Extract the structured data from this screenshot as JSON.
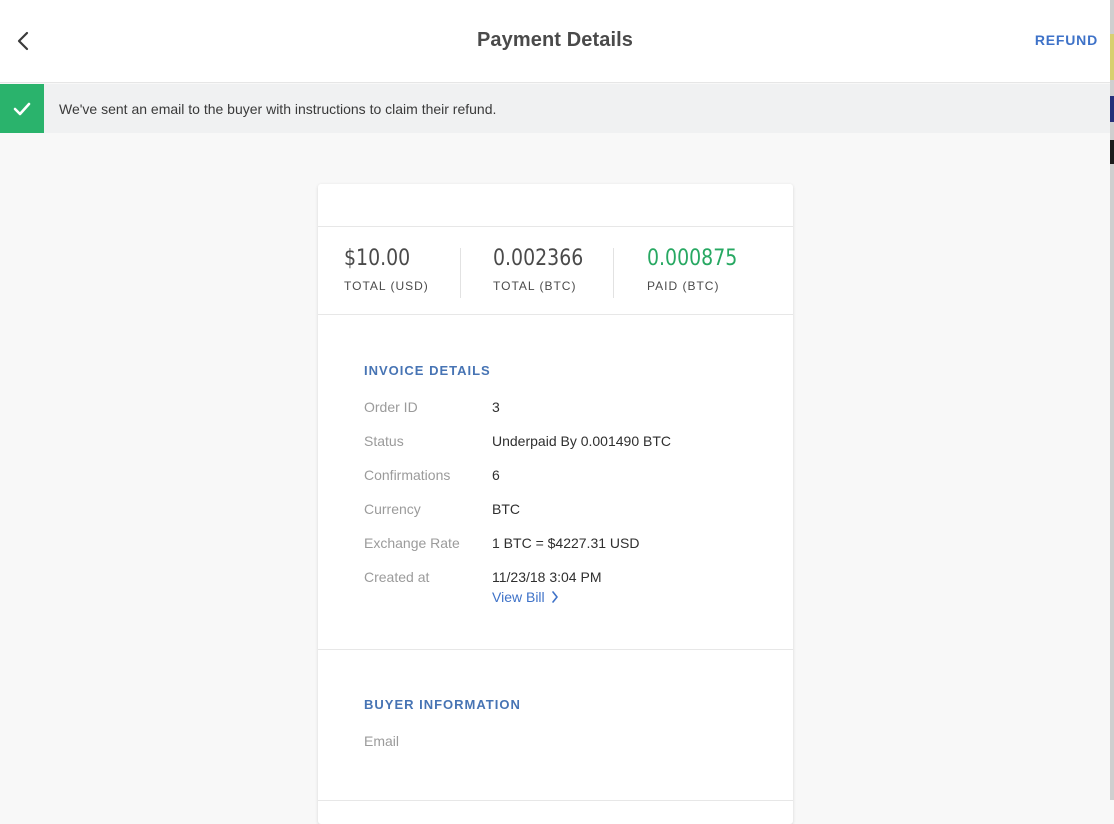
{
  "header": {
    "title": "Payment Details",
    "refund_label": "REFUND",
    "back_icon": "chevron-left-icon"
  },
  "notice": {
    "icon": "checkmark-icon",
    "text": "We've sent an email to the buyer with instructions to claim their refund.",
    "color": "#2ab36c"
  },
  "totals": [
    {
      "amount": "$10.00",
      "label": "TOTAL (USD)"
    },
    {
      "amount": "0.002366",
      "label": "TOTAL (BTC)"
    },
    {
      "amount": "0.000875",
      "label": "PAID (BTC)"
    }
  ],
  "invoice": {
    "title": "INVOICE DETAILS",
    "rows": [
      {
        "key": "Order ID",
        "value": "3"
      },
      {
        "key": "Status",
        "value": "Underpaid By 0.001490 BTC"
      },
      {
        "key": "Confirmations",
        "value": "6"
      },
      {
        "key": "Currency",
        "value": "BTC"
      },
      {
        "key": "Exchange Rate",
        "value": "1 BTC = $4227.31 USD"
      },
      {
        "key": "Created at",
        "value": "11/23/18 3:04 PM"
      }
    ],
    "view_bill_label": "View Bill"
  },
  "buyer": {
    "title": "BUYER INFORMATION",
    "rows": [
      {
        "key": "Email",
        "value": ""
      }
    ]
  },
  "colors": {
    "accent": "#3e72c8",
    "section_title": "#4774b4",
    "paid_green": "#27a862"
  }
}
